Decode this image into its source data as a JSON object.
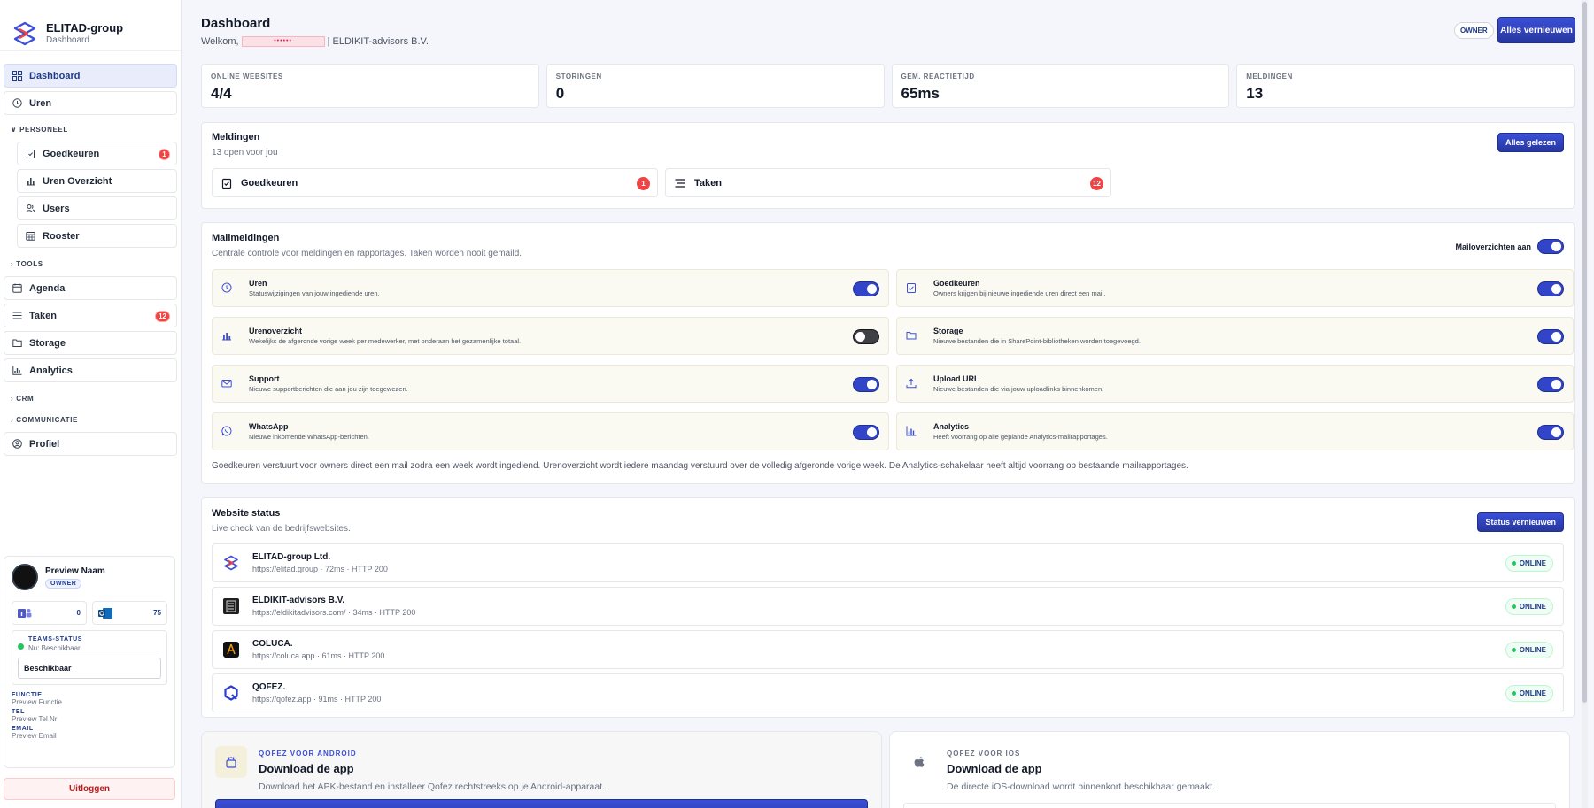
{
  "brand": {
    "name": "ELITAD-group",
    "subtitle": "Dashboard"
  },
  "sidebar": {
    "items": [
      {
        "label": "Dashboard",
        "icon": "dashboard-icon",
        "active": true
      },
      {
        "label": "Uren",
        "icon": "clock-icon"
      }
    ],
    "personeel": {
      "label": "PERSONEEL",
      "items": [
        {
          "label": "Goedkeuren",
          "icon": "clipboard-check-icon",
          "badge": "1"
        },
        {
          "label": "Uren Overzicht",
          "icon": "bar-chart-icon"
        },
        {
          "label": "Users",
          "icon": "users-icon"
        },
        {
          "label": "Rooster",
          "icon": "calendar-grid-icon"
        }
      ]
    },
    "tools_label": "TOOLS",
    "mid_items": [
      {
        "label": "Agenda",
        "icon": "calendar-icon"
      },
      {
        "label": "Taken",
        "icon": "list-icon",
        "badge": "12"
      },
      {
        "label": "Storage",
        "icon": "folder-icon"
      },
      {
        "label": "Analytics",
        "icon": "analytics-icon"
      }
    ],
    "crm_label": "CRM",
    "communicatie_label": "COMMUNICATIE",
    "profiel": {
      "label": "Profiel",
      "icon": "user-circle-icon"
    }
  },
  "profile": {
    "name": "Preview Naam",
    "role": "OWNER",
    "teams_count": "0",
    "outlook_count": "75",
    "teams_status_title": "TEAMS-STATUS",
    "teams_status_now": "Nu: Beschikbaar",
    "teams_select": "Beschikbaar",
    "functie_label": "FUNCTIE",
    "functie_value": "Preview Functie",
    "tel_label": "TEL",
    "tel_value": "Preview Tel Nr",
    "email_label": "EMAIL",
    "email_value": "Preview Email",
    "logout": "Uitloggen"
  },
  "header": {
    "title": "Dashboard",
    "welcome_prefix": "Welkom,",
    "masked_name": "••••••",
    "company": "| ELDIKIT-advisors B.V.",
    "owner_pill": "OWNER",
    "refresh_all": "Alles vernieuwen"
  },
  "stats": [
    {
      "label": "ONLINE WEBSITES",
      "value": "4/4"
    },
    {
      "label": "STORINGEN",
      "value": "0"
    },
    {
      "label": "GEM. REACTIETIJD",
      "value": "65ms"
    },
    {
      "label": "MELDINGEN",
      "value": "13"
    }
  ],
  "notifications": {
    "title": "Meldingen",
    "subtitle": "13 open voor jou",
    "mark_read": "Alles gelezen",
    "tiles": [
      {
        "label": "Goedkeuren",
        "badge": "1",
        "icon": "clipboard-check-icon"
      },
      {
        "label": "Taken",
        "badge": "12",
        "icon": "list-icon"
      }
    ]
  },
  "mail": {
    "title": "Mailmeldingen",
    "subtitle": "Centrale controle voor meldingen en rapportages. Taken worden nooit gemaild.",
    "master_label": "Mailoverzichten aan",
    "master_on": true,
    "tiles": [
      {
        "title": "Uren",
        "desc": "Statuswijzigingen van jouw ingediende uren.",
        "icon": "clock-icon",
        "on": true
      },
      {
        "title": "Goedkeuren",
        "desc": "Owners krijgen bij nieuwe ingediende uren direct een mail.",
        "icon": "clipboard-check-icon",
        "on": true
      },
      {
        "title": "Urenoverzicht",
        "desc": "Wekelijks de afgeronde vorige week per medewerker, met onderaan het gezamenlijke totaal.",
        "icon": "bar-chart-icon",
        "on": false
      },
      {
        "title": "Storage",
        "desc": "Nieuwe bestanden die in SharePoint-bibliotheken worden toegevoegd.",
        "icon": "folder-icon",
        "on": true
      },
      {
        "title": "Support",
        "desc": "Nieuwe supportberichten die aan jou zijn toegewezen.",
        "icon": "mail-icon",
        "on": true
      },
      {
        "title": "Upload URL",
        "desc": "Nieuwe bestanden die via jouw uploadlinks binnenkomen.",
        "icon": "upload-icon",
        "on": true
      },
      {
        "title": "WhatsApp",
        "desc": "Nieuwe inkomende WhatsApp-berichten.",
        "icon": "whatsapp-icon",
        "on": true
      },
      {
        "title": "Analytics",
        "desc": "Heeft voorrang op alle geplande Analytics-mailrapportages.",
        "icon": "analytics-icon",
        "on": true
      }
    ],
    "note": "Goedkeuren verstuurt voor owners direct een mail zodra een week wordt ingediend. Urenoverzicht wordt iedere maandag verstuurd over de volledig afgeronde vorige week. De Analytics-schakelaar heeft altijd voorrang op bestaande mailrapportages."
  },
  "websites": {
    "title": "Website status",
    "subtitle": "Live check van de bedrijfswebsites.",
    "refresh": "Status vernieuwen",
    "rows": [
      {
        "name": "ELITAD-group Ltd.",
        "meta": "https://elitad.group · 72ms · HTTP 200",
        "status": "ONLINE",
        "logo": "elitad-logo-icon"
      },
      {
        "name": "ELDIKIT-advisors B.V.",
        "meta": "https://eldikitadvisors.com/ · 34ms · HTTP 200",
        "status": "ONLINE",
        "logo": "eldikit-logo-icon"
      },
      {
        "name": "COLUCA.",
        "meta": "https://coluca.app · 61ms · HTTP 200",
        "status": "ONLINE",
        "logo": "coluca-logo-icon"
      },
      {
        "name": "QOFEZ.",
        "meta": "https://qofez.app · 91ms · HTTP 200",
        "status": "ONLINE",
        "logo": "qofez-logo-icon"
      }
    ]
  },
  "apps": {
    "android": {
      "kicker": "QOFEZ VOOR ANDROID",
      "title": "Download de app",
      "desc": "Download het APK-bestand en installeer Qofez rechtstreeks op je Android-apparaat."
    },
    "ios": {
      "kicker": "QOFEZ VOOR IOS",
      "title": "Download de app",
      "desc": "De directe iOS-download wordt binnenkort beschikbaar gemaakt."
    }
  },
  "colors": {
    "accent": "#3245c9",
    "danger": "#ef4444",
    "success": "#22c55e"
  }
}
